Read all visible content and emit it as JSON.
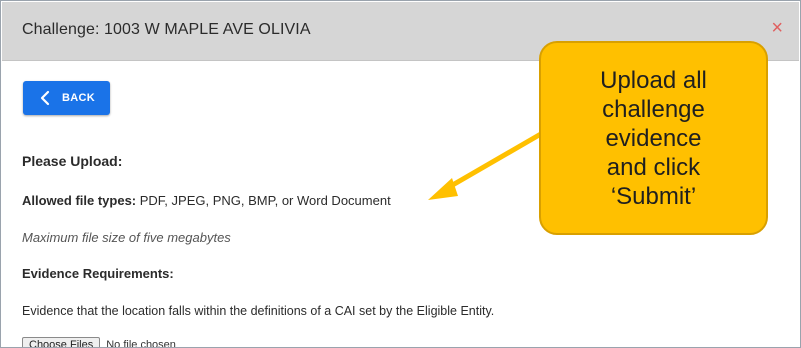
{
  "dialog": {
    "title": "Challenge: 1003 W MAPLE AVE OLIVIA",
    "close_symbol": "×"
  },
  "back_button": {
    "label": "BACK",
    "icon": "chevron-left-icon"
  },
  "content": {
    "please_upload": "Please Upload:",
    "allowed_label": "Allowed file types:",
    "allowed_value": " PDF, JPEG, PNG, BMP, or Word Document",
    "max_size": "Maximum file size of five megabytes",
    "evidence_heading": "Evidence Requirements:",
    "evidence_text": "Evidence that the location falls within the definitions of a CAI set by the Eligible Entity."
  },
  "file_input": {
    "button_label": "Choose Files",
    "status": "No file chosen"
  },
  "callout": {
    "text": "Upload all\nchallenge\nevidence\nand click\n‘Submit’",
    "fill": "#ffc000",
    "arrow_color": "#ffc000"
  },
  "colors": {
    "accent": "#1a73e8",
    "header_bg": "#d6d6d6",
    "close": "#e06060"
  }
}
